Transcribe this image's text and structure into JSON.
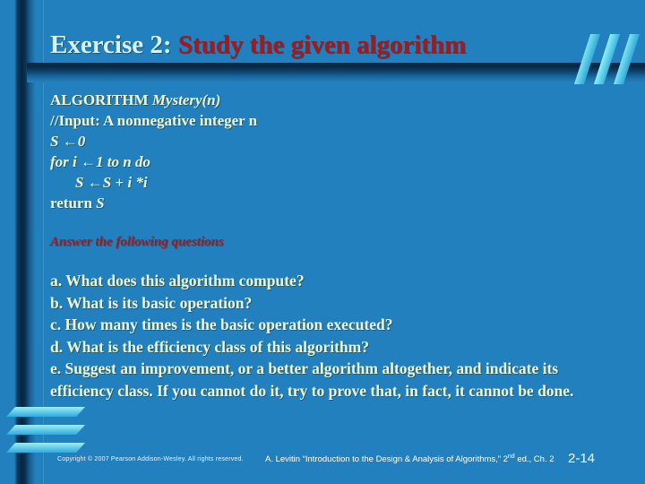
{
  "slide": {
    "background_color": "#2280be",
    "title": {
      "main": "Exercise 2:",
      "accent": "Study the given algorithm",
      "main_color": "#d6f2f7",
      "accent_color": "#a81818"
    },
    "algorithm": {
      "lines": [
        "ALGORITHM Mystery(n)",
        "//Input: A nonnegative integer n",
        "S ←0",
        "for i ←1 to n do",
        "S ←S + i *i",
        "return S"
      ],
      "header_keyword": "ALGORITHM",
      "header_name": "Mystery(n)",
      "line2": "//Input: A nonnegative integer n",
      "line3": "S ←0",
      "line4": "for i ←1 to n do",
      "line5": "S ←S + i *i",
      "line6": "return S",
      "text_color": "#f2f6ce"
    },
    "answer_heading": "Answer the following questions",
    "questions": [
      "a. What does this algorithm compute?",
      "b. What is its basic operation?",
      "c. How many times is the basic operation executed?",
      "d. What is the efficiency class of this algorithm?",
      "e. Suggest an improvement, or a better algorithm altogether, and indicate its efficiency class. If you cannot do it, try to prove that, in fact, it cannot be done."
    ],
    "footer": {
      "copyright": "Copyright © 2007 Pearson Addison-Wesley. All rights reserved.",
      "citation_pre": "A. Levitin “Introduction to the Design & Analysis of Algorithms,” 2",
      "citation_sup": "nd",
      "citation_post": " ed., Ch. 2",
      "page_number": "2-14"
    },
    "decorations": {
      "top_right": "three-slashes-icon",
      "bottom_left": "three-bars-icon",
      "left_stripe": "vertical-stripe",
      "separator": "horizontal-bar"
    }
  }
}
